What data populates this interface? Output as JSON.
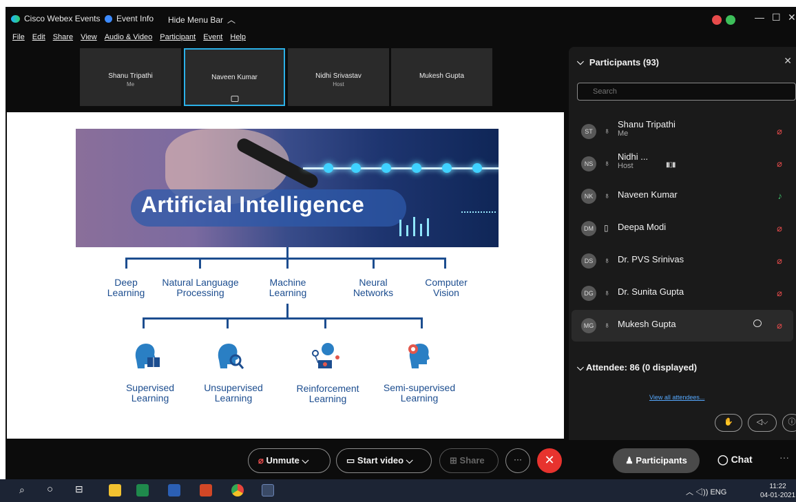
{
  "titlebar": {
    "app_name": "Cisco Webex Events",
    "event_info": "Event Info",
    "hide_menu": "Hide Menu Bar",
    "hide_menu_chevron": "︿",
    "minimize": "—",
    "maximize": "☐",
    "close": "✕"
  },
  "menubar": [
    "File",
    "Edit",
    "Share",
    "View",
    "Audio & Video",
    "Participant",
    "Event",
    "Help"
  ],
  "tiles": [
    {
      "name": "Shanu Tripathi",
      "role": "Me"
    },
    {
      "name": "Naveen Kumar",
      "role": ""
    },
    {
      "name": "Nidhi Srivastav",
      "role": "Host"
    },
    {
      "name": "Mukesh Gupta",
      "role": ""
    }
  ],
  "slide": {
    "title": "Artificial Intelligence",
    "level1": [
      "Deep\nLearning",
      "Natural Language\nProcessing",
      "Machine\nLearning",
      "Neural\nNetworks",
      "Computer\nVision"
    ],
    "level2": [
      "Supervised\nLearning",
      "Unsupervised\nLearning",
      "Reinforcement\nLearning",
      "Semi-supervised\nLearning"
    ]
  },
  "panel": {
    "title": "Participants (93)",
    "close": "✕",
    "search_placeholder": "Search",
    "participants": [
      {
        "initials": "ST",
        "name": "Shanu Tripathi",
        "sub": "Me",
        "device": "headset",
        "mic": "muted"
      },
      {
        "initials": "NS",
        "name": "Nidhi ...",
        "sub": "Host",
        "device": "headset",
        "mic": "muted"
      },
      {
        "initials": "NK",
        "name": "Naveen Kumar",
        "sub": "",
        "device": "headset",
        "mic": "on"
      },
      {
        "initials": "DM",
        "name": "Deepa Modi",
        "sub": "",
        "device": "phone",
        "mic": "muted"
      },
      {
        "initials": "DS",
        "name": "Dr. PVS Srinivas",
        "sub": "",
        "device": "headset",
        "mic": "muted"
      },
      {
        "initials": "DG",
        "name": "Dr. Sunita Gupta",
        "sub": "",
        "device": "headset",
        "mic": "muted"
      },
      {
        "initials": "MG",
        "name": "Mukesh Gupta",
        "sub": "",
        "device": "headset",
        "mic": "muted"
      }
    ],
    "attendee": "Attendee: 86 (0 displayed)",
    "view_all": "View all attendees..."
  },
  "controls": {
    "unmute": "Unmute",
    "start_video": "Start video",
    "share": "Share",
    "more": "···",
    "end": "✕",
    "participants": "Participants",
    "chat": "Chat",
    "overflow": "···"
  },
  "taskbar": {
    "tray": "︿  ◁))  ENG",
    "time": "11:22",
    "date": "04-01-2021"
  },
  "colors": {
    "accent_blue": "#1c4d8f",
    "active_tile": "#2bb1e8",
    "end_call": "#e7332e",
    "mic_muted": "#e74b4b",
    "mic_on": "#3fc06a"
  }
}
